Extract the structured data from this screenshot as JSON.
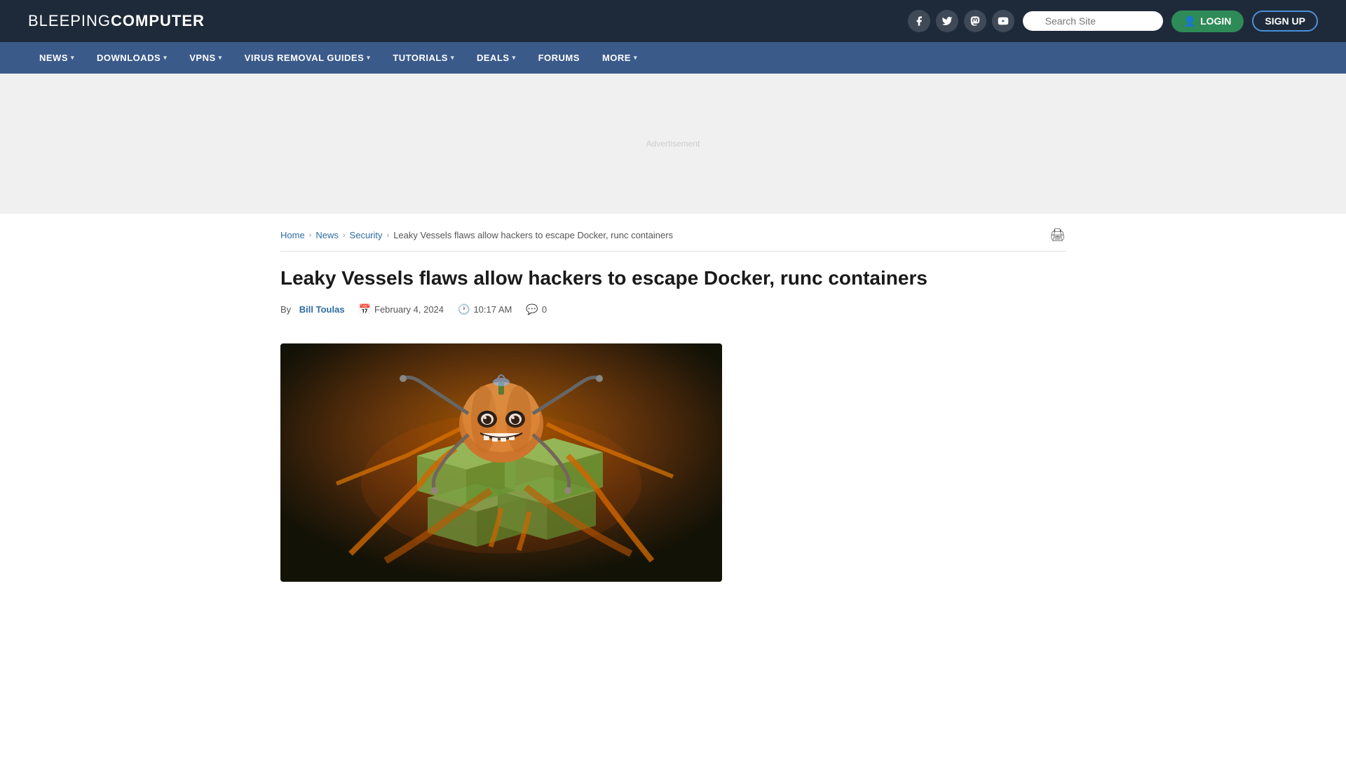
{
  "site": {
    "logo_prefix": "BLEEPING",
    "logo_suffix": "COMPUTER"
  },
  "header": {
    "social": [
      {
        "name": "facebook",
        "icon": "f"
      },
      {
        "name": "twitter",
        "icon": "𝕏"
      },
      {
        "name": "mastodon",
        "icon": "m"
      },
      {
        "name": "youtube",
        "icon": "▶"
      }
    ],
    "search_placeholder": "Search Site",
    "login_label": "LOGIN",
    "signup_label": "SIGN UP"
  },
  "nav": {
    "items": [
      {
        "label": "NEWS",
        "has_dropdown": true
      },
      {
        "label": "DOWNLOADS",
        "has_dropdown": true
      },
      {
        "label": "VPNS",
        "has_dropdown": true
      },
      {
        "label": "VIRUS REMOVAL GUIDES",
        "has_dropdown": true
      },
      {
        "label": "TUTORIALS",
        "has_dropdown": true
      },
      {
        "label": "DEALS",
        "has_dropdown": true
      },
      {
        "label": "FORUMS",
        "has_dropdown": false
      },
      {
        "label": "MORE",
        "has_dropdown": true
      }
    ]
  },
  "breadcrumb": {
    "items": [
      {
        "label": "Home",
        "href": "#"
      },
      {
        "label": "News",
        "href": "#"
      },
      {
        "label": "Security",
        "href": "#"
      }
    ],
    "current": "Leaky Vessels flaws allow hackers to escape Docker, runc containers"
  },
  "article": {
    "title": "Leaky Vessels flaws allow hackers to escape Docker, runc containers",
    "author": {
      "prefix": "By",
      "name": "Bill Toulas",
      "href": "#"
    },
    "date": "February 4, 2024",
    "time": "10:17 AM",
    "comments": "0"
  },
  "colors": {
    "header_bg": "#1e2a3a",
    "nav_bg": "#3a5a8a",
    "link_color": "#2e6da4",
    "login_bg": "#2e8b57",
    "signup_border": "#4a90d9"
  }
}
